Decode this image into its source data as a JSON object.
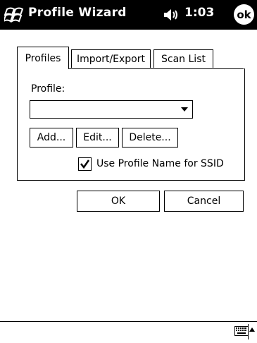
{
  "titlebar": {
    "title": "Profile Wizard",
    "time": "1:03",
    "ok": "ok"
  },
  "tabs": [
    {
      "label": "Profiles",
      "active": true
    },
    {
      "label": "Import/Export",
      "active": false
    },
    {
      "label": "Scan List",
      "active": false
    }
  ],
  "profiles": {
    "profile_label": "Profile:",
    "profile_value": "",
    "add_label": "Add...",
    "edit_label": "Edit...",
    "delete_label": "Delete...",
    "ssid_checkbox_label": "Use Profile Name for SSID",
    "ssid_checked": true
  },
  "dialog": {
    "ok_label": "OK",
    "cancel_label": "Cancel"
  },
  "icons": {
    "start": "windows-flag-icon",
    "volume": "speaker-icon",
    "keyboard": "keyboard-icon"
  }
}
